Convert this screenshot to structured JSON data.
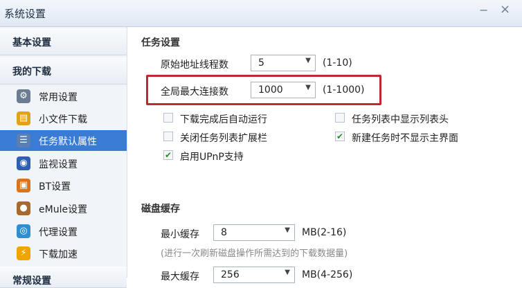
{
  "window": {
    "title": "系统设置",
    "minimize_glyph": "−",
    "close_glyph": "×"
  },
  "sidebar": {
    "categories": [
      {
        "label": "基本设置"
      },
      {
        "label": "我的下载"
      },
      {
        "label": "常规设置"
      }
    ],
    "items": [
      {
        "label": "常用设置",
        "icon": "gear-icon",
        "glyph": "⚙",
        "color": "#6b7c93"
      },
      {
        "label": "小文件下载",
        "icon": "folder-download-icon",
        "glyph": "▤",
        "color": "#e0a21b"
      },
      {
        "label": "任务默认属性",
        "icon": "task-list-icon",
        "glyph": "☰",
        "color": "#5b7fb0"
      },
      {
        "label": "监视设置",
        "icon": "monitor-eye-icon",
        "glyph": "◉",
        "color": "#2f5fb5"
      },
      {
        "label": "BT设置",
        "icon": "bt-folder-icon",
        "glyph": "▣",
        "color": "#d9741c"
      },
      {
        "label": "eMule设置",
        "icon": "emule-icon",
        "glyph": "●",
        "color": "#a86a2c"
      },
      {
        "label": "代理设置",
        "icon": "proxy-globe-icon",
        "glyph": "◎",
        "color": "#2f8fd0"
      },
      {
        "label": "下载加速",
        "icon": "lightning-icon",
        "glyph": "⚡",
        "color": "#f0a400"
      }
    ]
  },
  "task_settings": {
    "title": "任务设置",
    "threads_label": "原始地址线程数",
    "threads_value": "5",
    "threads_range": "(1-10)",
    "max_conn_label": "全局最大连接数",
    "max_conn_value": "1000",
    "max_conn_range": "(1-1000)",
    "checkboxes": {
      "auto_run": {
        "label": "下载完成后自动运行",
        "checked": false
      },
      "show_header": {
        "label": "任务列表中显示列表头",
        "checked": false
      },
      "close_expand": {
        "label": "关闭任务列表扩展栏",
        "checked": false
      },
      "no_main_window": {
        "label": "新建任务时不显示主界面",
        "checked": true
      },
      "upnp": {
        "label": "启用UPnP支持",
        "checked": true
      }
    },
    "check_glyph": "✔"
  },
  "disk_cache": {
    "title": "磁盘缓存",
    "min_label": "最小缓存",
    "min_value": "8",
    "min_unit": "MB(2-16)",
    "min_note": "(进行一次刷新磁盘操作所需达到的下载数据量)",
    "max_label": "最大缓存",
    "max_value": "256",
    "max_unit": "MB(4-256)"
  },
  "dropdown_glyph": "▼",
  "colors": {
    "highlight": "#c2272d",
    "selected": "#3a7bd5"
  }
}
